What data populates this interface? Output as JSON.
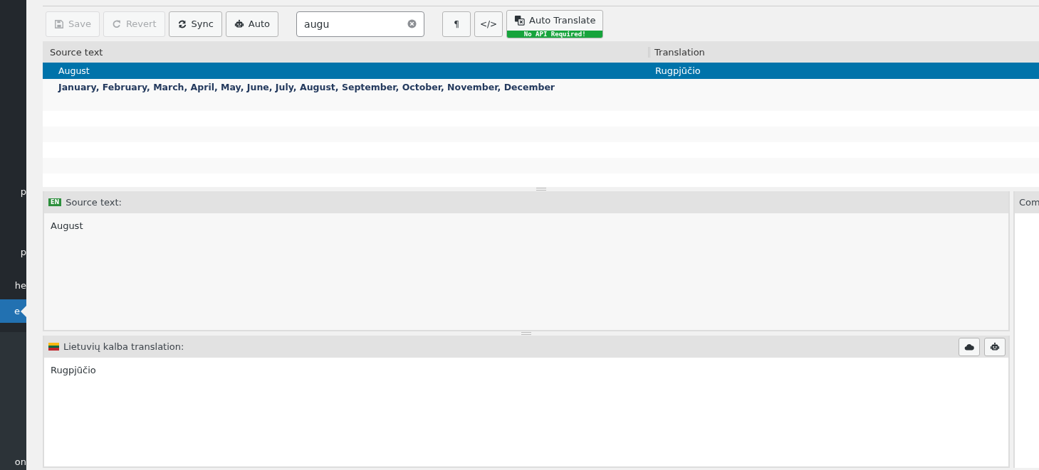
{
  "sidebar": {
    "items": [
      {
        "label": "p",
        "selected": false
      },
      {
        "label": "p",
        "selected": false
      },
      {
        "label": "he",
        "selected": false
      },
      {
        "label": "e",
        "selected": true
      },
      {
        "label": "on",
        "selected": false
      }
    ]
  },
  "toolbar": {
    "buttons": [
      {
        "label": "Save",
        "kind": "save",
        "disabled": true
      },
      {
        "label": "Revert",
        "kind": "revert",
        "disabled": true
      },
      {
        "label": "Sync",
        "kind": "sync",
        "disabled": false
      },
      {
        "label": "Auto",
        "kind": "robot",
        "disabled": false
      }
    ],
    "search": {
      "value": "augu"
    },
    "tool_buttons": [
      "¶",
      "</>"
    ],
    "auto_translate": {
      "label": "Auto Translate",
      "badge": "No API Required!"
    }
  },
  "table": {
    "columns": [
      "Source text",
      "Translation"
    ],
    "rows": [
      {
        "source": "August",
        "translation": "Rugpjūčio",
        "selected": true,
        "untranslated": false
      },
      {
        "source": "January, February, March, April, May, June, July, August, September, October, November, December",
        "selected": false,
        "untranslated": true
      }
    ]
  },
  "source_panel": {
    "lang_badge": "EN",
    "title": "Source text:",
    "text": "August"
  },
  "translation_panel": {
    "title": "Lietuvių kalba translation:",
    "text": "Rugpjūčio"
  },
  "comments_panel": {
    "title": "Com"
  }
}
